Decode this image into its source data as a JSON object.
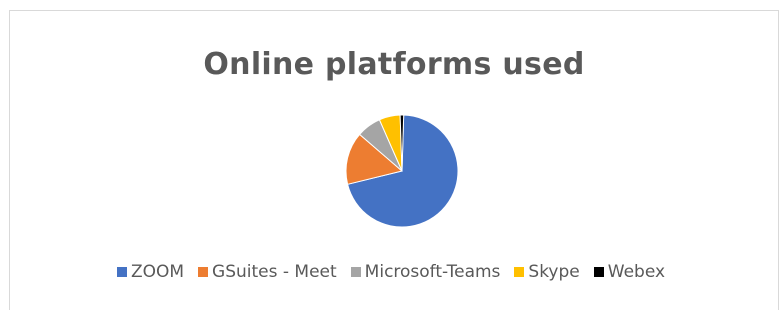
{
  "chart_data": {
    "type": "pie",
    "title": "Online platforms used",
    "categories": [
      "ZOOM",
      "GSuites - Meet",
      "Microsoft-Teams",
      "Skype",
      "Webex"
    ],
    "values": [
      70,
      15,
      7,
      6,
      1
    ],
    "colors": [
      "#4472c4",
      "#ed7d31",
      "#a5a5a5",
      "#ffc000",
      "#000000"
    ],
    "legend": "bottom"
  }
}
